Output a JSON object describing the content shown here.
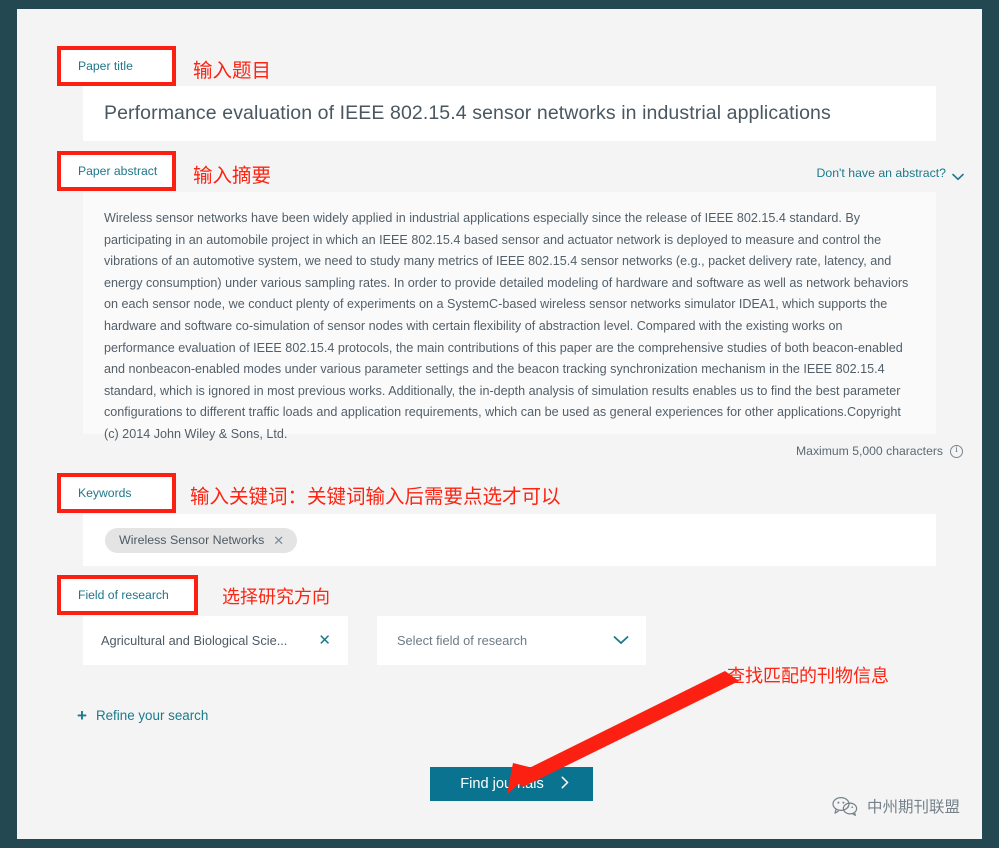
{
  "theme": {
    "frame_color": "#234851",
    "canvas_bg": "#f4f4f4",
    "accent_teal": "#0a7490",
    "link_teal": "#1a7a8c",
    "annotation_red": "#fb2012",
    "text_gray": "#4d5a64"
  },
  "annotations": {
    "title_box_label": "Paper title",
    "title_note": "输入题目",
    "abstract_box_label": "Paper abstract",
    "abstract_note": "输入摘要",
    "keywords_box_label": "Keywords",
    "keywords_note": "输入关键词：关键词输入后需要点选才可以",
    "field_of_research_box_label": "Field of research",
    "field_of_research_note": "选择研究方向",
    "find_journals_note": "查找匹配的刊物信息"
  },
  "paper_title": {
    "value": "Performance evaluation of IEEE 802.15.4 sensor networks in industrial applications"
  },
  "abstract": {
    "no_abstract_link": "Don't have an abstract?",
    "chevron_icon": "chevron-down-icon",
    "value": "Wireless sensor networks have been widely applied in industrial applications especially since the release of IEEE 802.15.4 standard. By participating in an automobile project in which an IEEE 802.15.4 based sensor and actuator network is deployed to measure and control the vibrations of an automotive system, we need to study many metrics of IEEE 802.15.4 sensor networks (e.g., packet delivery rate, latency, and energy consumption) under various sampling rates. In order to provide detailed modeling of hardware and software as well as network behaviors on each sensor node, we conduct plenty of experiments on a SystemC-based wireless sensor networks simulator IDEA1, which supports the hardware and software co-simulation of sensor nodes with certain flexibility of abstraction level. Compared with the existing works on performance evaluation of IEEE 802.15.4 protocols, the main contributions of this paper are the comprehensive studies of both beacon-enabled and nonbeacon-enabled modes under various parameter settings and the beacon tracking synchronization mechanism in the IEEE 802.15.4 standard, which is ignored in most previous works. Additionally, the in-depth analysis of simulation results enables us to find the best parameter configurations to different traffic loads and application requirements, which can be used as general experiences for other applications.Copyright (c) 2014 John Wiley & Sons, Ltd.",
    "max_chars_label": "Maximum 5,000 characters",
    "info_icon": "info-icon"
  },
  "keywords": {
    "chips": [
      {
        "label": "Wireless Sensor Networks",
        "remove_icon": "close-icon"
      }
    ]
  },
  "field_of_research": {
    "selected": {
      "label": "Agricultural and Biological Scie...",
      "remove_icon": "close-icon"
    },
    "select_placeholder": "Select field of research",
    "chevron_icon": "chevron-down-icon"
  },
  "refine": {
    "label": "Refine your search",
    "plus_icon": "plus-icon"
  },
  "find_journals": {
    "label": "Find journals",
    "arrow_icon": "chevron-right-icon"
  },
  "watermark": {
    "icon": "wechat-icon",
    "text": "中州期刊联盟"
  }
}
